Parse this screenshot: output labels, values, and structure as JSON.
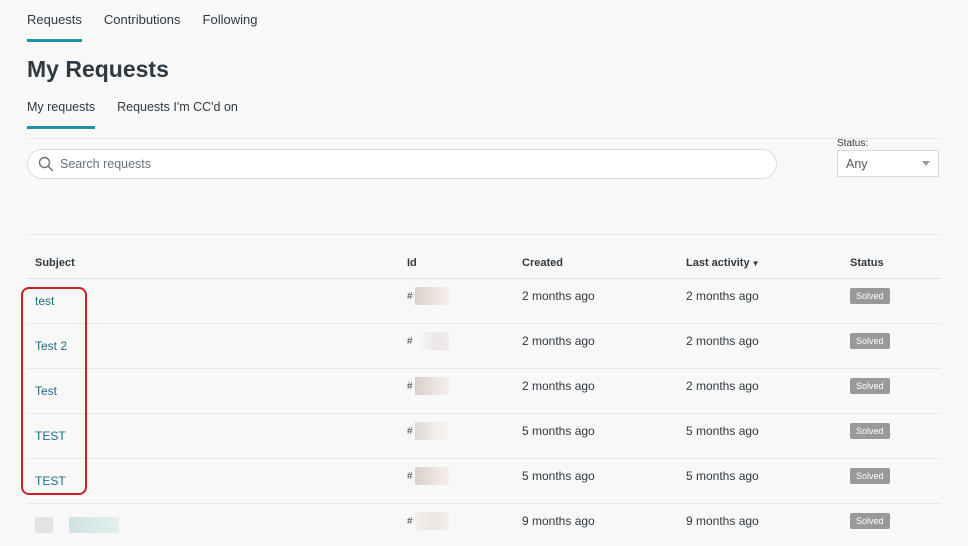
{
  "top_tabs": [
    {
      "label": "Requests",
      "active": true
    },
    {
      "label": "Contributions",
      "active": false
    },
    {
      "label": "Following",
      "active": false
    }
  ],
  "page_title": "My Requests",
  "sub_tabs": [
    {
      "label": "My requests",
      "active": true
    },
    {
      "label": "Requests I'm CC'd on",
      "active": false
    }
  ],
  "search": {
    "placeholder": "Search requests",
    "value": ""
  },
  "status_filter": {
    "label": "Status:",
    "selected": "Any"
  },
  "table": {
    "headers": {
      "subject": "Subject",
      "id": "Id",
      "created": "Created",
      "last_activity": "Last activity",
      "status": "Status"
    },
    "sort_indicator": "▼",
    "rows": [
      {
        "subject": "test",
        "id": "#",
        "created": "2 months ago",
        "last_activity": "2 months ago",
        "status": "Solved"
      },
      {
        "subject": "Test 2",
        "id": "#",
        "created": "2 months ago",
        "last_activity": "2 months ago",
        "status": "Solved"
      },
      {
        "subject": "Test",
        "id": "#",
        "created": "2 months ago",
        "last_activity": "2 months ago",
        "status": "Solved"
      },
      {
        "subject": "TEST",
        "id": "#",
        "created": "5 months ago",
        "last_activity": "5 months ago",
        "status": "Solved"
      },
      {
        "subject": "TEST",
        "id": "#",
        "created": "5 months ago",
        "last_activity": "5 months ago",
        "status": "Solved"
      },
      {
        "subject": "",
        "id": "#",
        "created": "9 months ago",
        "last_activity": "9 months ago",
        "status": "Solved"
      }
    ]
  },
  "colors": {
    "accent": "#1f8fa6",
    "highlight": "#cc1f1f",
    "badge": "#999999"
  }
}
